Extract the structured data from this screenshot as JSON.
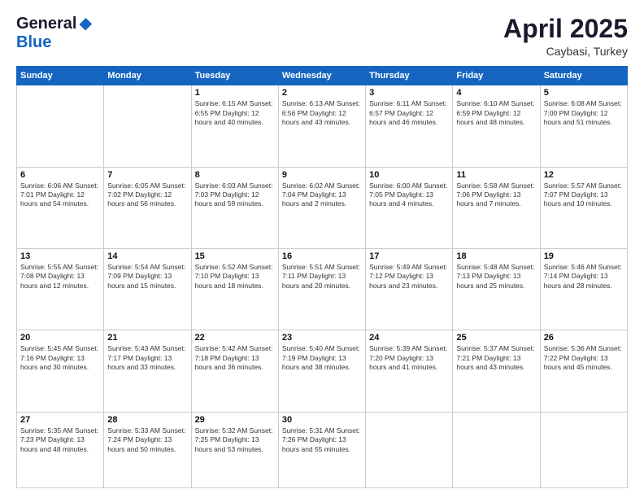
{
  "header": {
    "logo_general": "General",
    "logo_blue": "Blue",
    "title": "April 2025",
    "location": "Caybasi, Turkey"
  },
  "days_of_week": [
    "Sunday",
    "Monday",
    "Tuesday",
    "Wednesday",
    "Thursday",
    "Friday",
    "Saturday"
  ],
  "weeks": [
    [
      {
        "day": "",
        "info": ""
      },
      {
        "day": "",
        "info": ""
      },
      {
        "day": "1",
        "info": "Sunrise: 6:15 AM\nSunset: 6:55 PM\nDaylight: 12 hours\nand 40 minutes."
      },
      {
        "day": "2",
        "info": "Sunrise: 6:13 AM\nSunset: 6:56 PM\nDaylight: 12 hours\nand 43 minutes."
      },
      {
        "day": "3",
        "info": "Sunrise: 6:11 AM\nSunset: 6:57 PM\nDaylight: 12 hours\nand 46 minutes."
      },
      {
        "day": "4",
        "info": "Sunrise: 6:10 AM\nSunset: 6:59 PM\nDaylight: 12 hours\nand 48 minutes."
      },
      {
        "day": "5",
        "info": "Sunrise: 6:08 AM\nSunset: 7:00 PM\nDaylight: 12 hours\nand 51 minutes."
      }
    ],
    [
      {
        "day": "6",
        "info": "Sunrise: 6:06 AM\nSunset: 7:01 PM\nDaylight: 12 hours\nand 54 minutes."
      },
      {
        "day": "7",
        "info": "Sunrise: 6:05 AM\nSunset: 7:02 PM\nDaylight: 12 hours\nand 56 minutes."
      },
      {
        "day": "8",
        "info": "Sunrise: 6:03 AM\nSunset: 7:03 PM\nDaylight: 12 hours\nand 59 minutes."
      },
      {
        "day": "9",
        "info": "Sunrise: 6:02 AM\nSunset: 7:04 PM\nDaylight: 13 hours\nand 2 minutes."
      },
      {
        "day": "10",
        "info": "Sunrise: 6:00 AM\nSunset: 7:05 PM\nDaylight: 13 hours\nand 4 minutes."
      },
      {
        "day": "11",
        "info": "Sunrise: 5:58 AM\nSunset: 7:06 PM\nDaylight: 13 hours\nand 7 minutes."
      },
      {
        "day": "12",
        "info": "Sunrise: 5:57 AM\nSunset: 7:07 PM\nDaylight: 13 hours\nand 10 minutes."
      }
    ],
    [
      {
        "day": "13",
        "info": "Sunrise: 5:55 AM\nSunset: 7:08 PM\nDaylight: 13 hours\nand 12 minutes."
      },
      {
        "day": "14",
        "info": "Sunrise: 5:54 AM\nSunset: 7:09 PM\nDaylight: 13 hours\nand 15 minutes."
      },
      {
        "day": "15",
        "info": "Sunrise: 5:52 AM\nSunset: 7:10 PM\nDaylight: 13 hours\nand 18 minutes."
      },
      {
        "day": "16",
        "info": "Sunrise: 5:51 AM\nSunset: 7:11 PM\nDaylight: 13 hours\nand 20 minutes."
      },
      {
        "day": "17",
        "info": "Sunrise: 5:49 AM\nSunset: 7:12 PM\nDaylight: 13 hours\nand 23 minutes."
      },
      {
        "day": "18",
        "info": "Sunrise: 5:48 AM\nSunset: 7:13 PM\nDaylight: 13 hours\nand 25 minutes."
      },
      {
        "day": "19",
        "info": "Sunrise: 5:46 AM\nSunset: 7:14 PM\nDaylight: 13 hours\nand 28 minutes."
      }
    ],
    [
      {
        "day": "20",
        "info": "Sunrise: 5:45 AM\nSunset: 7:16 PM\nDaylight: 13 hours\nand 30 minutes."
      },
      {
        "day": "21",
        "info": "Sunrise: 5:43 AM\nSunset: 7:17 PM\nDaylight: 13 hours\nand 33 minutes."
      },
      {
        "day": "22",
        "info": "Sunrise: 5:42 AM\nSunset: 7:18 PM\nDaylight: 13 hours\nand 36 minutes."
      },
      {
        "day": "23",
        "info": "Sunrise: 5:40 AM\nSunset: 7:19 PM\nDaylight: 13 hours\nand 38 minutes."
      },
      {
        "day": "24",
        "info": "Sunrise: 5:39 AM\nSunset: 7:20 PM\nDaylight: 13 hours\nand 41 minutes."
      },
      {
        "day": "25",
        "info": "Sunrise: 5:37 AM\nSunset: 7:21 PM\nDaylight: 13 hours\nand 43 minutes."
      },
      {
        "day": "26",
        "info": "Sunrise: 5:36 AM\nSunset: 7:22 PM\nDaylight: 13 hours\nand 45 minutes."
      }
    ],
    [
      {
        "day": "27",
        "info": "Sunrise: 5:35 AM\nSunset: 7:23 PM\nDaylight: 13 hours\nand 48 minutes."
      },
      {
        "day": "28",
        "info": "Sunrise: 5:33 AM\nSunset: 7:24 PM\nDaylight: 13 hours\nand 50 minutes."
      },
      {
        "day": "29",
        "info": "Sunrise: 5:32 AM\nSunset: 7:25 PM\nDaylight: 13 hours\nand 53 minutes."
      },
      {
        "day": "30",
        "info": "Sunrise: 5:31 AM\nSunset: 7:26 PM\nDaylight: 13 hours\nand 55 minutes."
      },
      {
        "day": "",
        "info": ""
      },
      {
        "day": "",
        "info": ""
      },
      {
        "day": "",
        "info": ""
      }
    ]
  ]
}
